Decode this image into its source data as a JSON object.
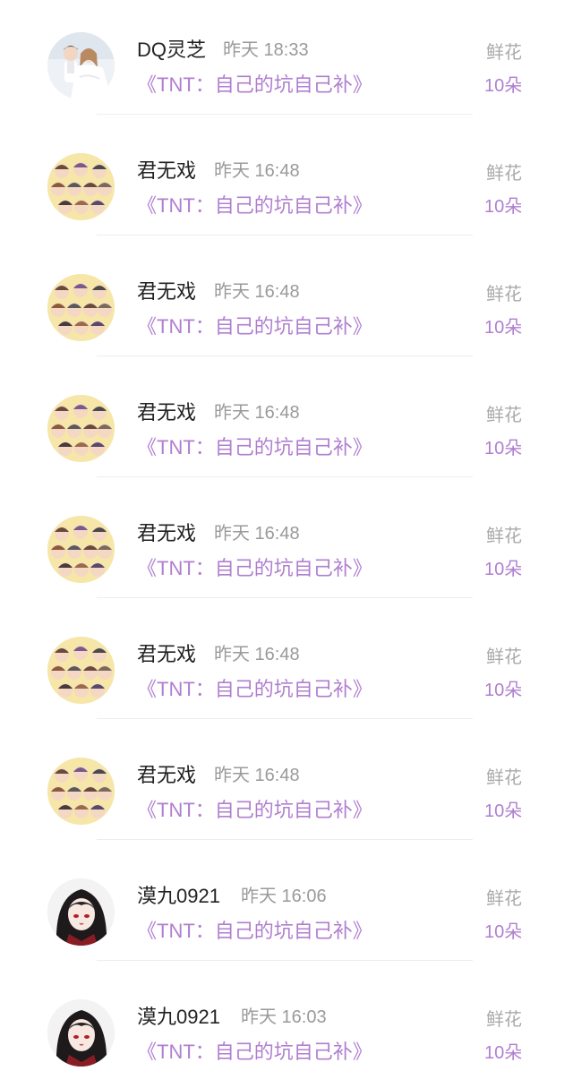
{
  "gift_list": {
    "items": [
      {
        "avatar": "wedding-photo-avatar",
        "user": "DQ灵芝",
        "time": "昨天 18:33",
        "book": "《TNT：自己的坑自己补》",
        "gift": "鲜花",
        "count": "10朵"
      },
      {
        "avatar": "group-cartoon-avatar",
        "user": "君无戏",
        "time": "昨天 16:48",
        "book": "《TNT：自己的坑自己补》",
        "gift": "鲜花",
        "count": "10朵"
      },
      {
        "avatar": "group-cartoon-avatar",
        "user": "君无戏",
        "time": "昨天 16:48",
        "book": "《TNT：自己的坑自己补》",
        "gift": "鲜花",
        "count": "10朵"
      },
      {
        "avatar": "group-cartoon-avatar",
        "user": "君无戏",
        "time": "昨天 16:48",
        "book": "《TNT：自己的坑自己补》",
        "gift": "鲜花",
        "count": "10朵"
      },
      {
        "avatar": "group-cartoon-avatar",
        "user": "君无戏",
        "time": "昨天 16:48",
        "book": "《TNT：自己的坑自己补》",
        "gift": "鲜花",
        "count": "10朵"
      },
      {
        "avatar": "group-cartoon-avatar",
        "user": "君无戏",
        "time": "昨天 16:48",
        "book": "《TNT：自己的坑自己补》",
        "gift": "鲜花",
        "count": "10朵"
      },
      {
        "avatar": "group-cartoon-avatar",
        "user": "君无戏",
        "time": "昨天 16:48",
        "book": "《TNT：自己的坑自己补》",
        "gift": "鲜花",
        "count": "10朵"
      },
      {
        "avatar": "anime-character-avatar",
        "user": "漠九0921",
        "time": "昨天 16:06",
        "book": "《TNT：自己的坑自己补》",
        "gift": "鲜花",
        "count": "10朵"
      },
      {
        "avatar": "anime-character-avatar",
        "user": "漠九0921",
        "time": "昨天 16:03",
        "book": "《TNT：自己的坑自己补》",
        "gift": "鲜花",
        "count": "10朵"
      }
    ]
  },
  "colors": {
    "accent_purple": "#b07fd0",
    "name_text": "#222222",
    "muted_text": "#9a9a9a"
  }
}
